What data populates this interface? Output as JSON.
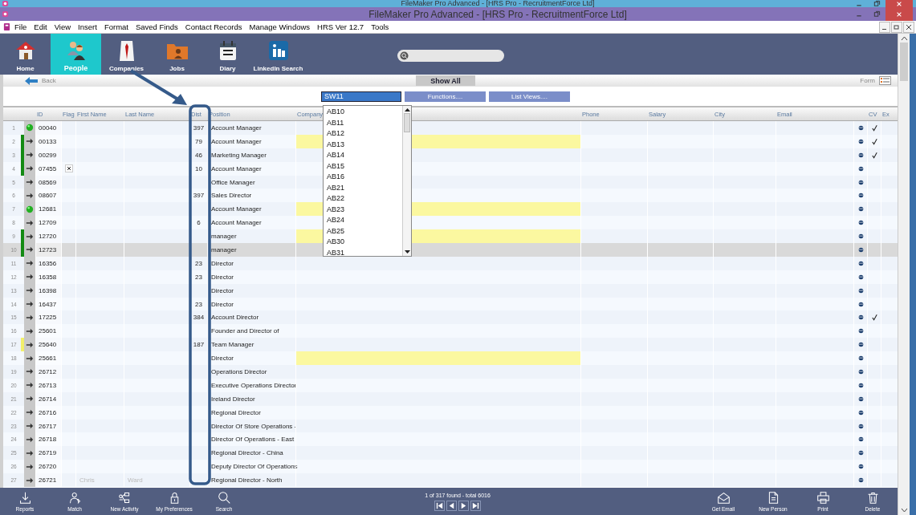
{
  "title_bars": [
    {
      "title": "FileMaker Pro Advanced - [HRS Pro - RecruitmentForce Ltd]",
      "active": false
    },
    {
      "title": "FileMaker Pro Advanced - [HRS Pro - RecruitmentForce Ltd]",
      "active": true
    }
  ],
  "menu": [
    "File",
    "Edit",
    "View",
    "Insert",
    "Format",
    "Saved Finds",
    "Contact Records",
    "Manage Windows",
    "HRS Ver 12.7",
    "Tools"
  ],
  "nav": [
    {
      "label": "Home",
      "kind": "home",
      "selected": false
    },
    {
      "label": "People",
      "kind": "people",
      "selected": true
    },
    {
      "label": "Companies",
      "kind": "shirt",
      "selected": false
    },
    {
      "label": "Jobs",
      "kind": "folder",
      "selected": false
    },
    {
      "label": "Diary",
      "kind": "calendar",
      "selected": false
    },
    {
      "label": "LinkedIn Search",
      "kind": "linkedin",
      "selected": false
    }
  ],
  "subbar": {
    "back": "Back",
    "show_all": "Show All",
    "view": "Form"
  },
  "filter": {
    "value": "SW11",
    "buttons": [
      "Functions....",
      "List Views...."
    ]
  },
  "dropdown": [
    "AB10",
    "AB11",
    "AB12",
    "AB13",
    "AB14",
    "AB15",
    "AB16",
    "AB21",
    "AB22",
    "AB23",
    "AB24",
    "AB25",
    "AB30",
    "AB31"
  ],
  "columns": [
    "ID",
    "Flag",
    "First Name",
    "Last Name",
    "Dist",
    "Position",
    "Company",
    "Phone",
    "Salary",
    "City",
    "Email",
    "CV",
    "Ex"
  ],
  "rows": [
    {
      "n": "1",
      "kind": "dot",
      "id": "00040",
      "flagged": false,
      "dist": "397",
      "position": "Account Manager",
      "highlight": false,
      "cv": true,
      "selected": false
    },
    {
      "n": "2",
      "kind": "arrow",
      "color": "#138a13",
      "id": "00133",
      "flagged": false,
      "dist": "79",
      "position": "Account Manager",
      "highlight": true,
      "cv": true,
      "selected": false
    },
    {
      "n": "3",
      "kind": "arrow",
      "color": "#138a13",
      "id": "00299",
      "flagged": false,
      "dist": "46",
      "position": "Marketing Manager",
      "highlight": false,
      "cv": true,
      "selected": false
    },
    {
      "n": "4",
      "kind": "arrow",
      "color": "#138a13",
      "id": "07455",
      "flagged": true,
      "dist": "10",
      "position": "Account Manager",
      "highlight": false,
      "cv": false,
      "selected": false
    },
    {
      "n": "5",
      "kind": "arrow",
      "id": "08569",
      "flagged": false,
      "dist": "",
      "position": "Office Manager",
      "highlight": false,
      "cv": false,
      "selected": false
    },
    {
      "n": "6",
      "kind": "arrow",
      "id": "08607",
      "flagged": false,
      "dist": "397",
      "position": "Sales Director",
      "highlight": false,
      "cv": false,
      "selected": false
    },
    {
      "n": "7",
      "kind": "dot",
      "id": "12681",
      "flagged": false,
      "dist": "",
      "position": "Account Manager",
      "highlight": true,
      "cv": false,
      "selected": false
    },
    {
      "n": "8",
      "kind": "arrow",
      "id": "12709",
      "flagged": false,
      "dist": "6",
      "position": "Account Manager",
      "highlight": false,
      "cv": false,
      "selected": false
    },
    {
      "n": "9",
      "kind": "arrow",
      "color": "#138a13",
      "id": "12720",
      "flagged": false,
      "dist": "",
      "position": "manager",
      "highlight": true,
      "cv": false,
      "selected": false
    },
    {
      "n": "10",
      "kind": "arrow",
      "color": "#138a13",
      "id": "12723",
      "flagged": false,
      "dist": "",
      "position": "manager",
      "highlight": false,
      "cv": false,
      "selected": true
    },
    {
      "n": "11",
      "kind": "arrow",
      "id": "16356",
      "flagged": false,
      "dist": "23",
      "position": "Director",
      "highlight": false,
      "cv": false,
      "selected": false
    },
    {
      "n": "12",
      "kind": "arrow",
      "id": "16358",
      "flagged": false,
      "dist": "23",
      "position": "Director",
      "highlight": false,
      "cv": false,
      "selected": false
    },
    {
      "n": "13",
      "kind": "arrow",
      "id": "16398",
      "flagged": false,
      "dist": "",
      "position": "Director",
      "highlight": false,
      "cv": false,
      "selected": false
    },
    {
      "n": "14",
      "kind": "arrow",
      "id": "16437",
      "flagged": false,
      "dist": "23",
      "position": "Director",
      "highlight": false,
      "cv": false,
      "selected": false
    },
    {
      "n": "15",
      "kind": "arrow",
      "id": "17225",
      "flagged": false,
      "dist": "384",
      "position": "Account Director",
      "highlight": false,
      "cv": true,
      "selected": false
    },
    {
      "n": "16",
      "kind": "arrow",
      "id": "25601",
      "flagged": false,
      "dist": "",
      "position": "Founder and Director of",
      "highlight": false,
      "cv": false,
      "selected": false
    },
    {
      "n": "17",
      "kind": "arrow",
      "color": "#f2f06a",
      "id": "25640",
      "flagged": false,
      "dist": "187",
      "position": "Team Manager",
      "highlight": false,
      "cv": false,
      "selected": false
    },
    {
      "n": "18",
      "kind": "arrow",
      "id": "25661",
      "flagged": false,
      "dist": "",
      "position": "Director",
      "highlight": true,
      "cv": false,
      "selected": false
    },
    {
      "n": "19",
      "kind": "arrow",
      "id": "26712",
      "flagged": false,
      "dist": "",
      "position": "Operations Director",
      "highlight": false,
      "cv": false,
      "selected": false
    },
    {
      "n": "20",
      "kind": "arrow",
      "id": "26713",
      "flagged": false,
      "dist": "",
      "position": "Executive Operations Director",
      "highlight": false,
      "cv": false,
      "selected": false
    },
    {
      "n": "21",
      "kind": "arrow",
      "id": "26714",
      "flagged": false,
      "dist": "",
      "position": "Ireland Director",
      "highlight": false,
      "cv": false,
      "selected": false
    },
    {
      "n": "22",
      "kind": "arrow",
      "id": "26716",
      "flagged": false,
      "dist": "",
      "position": "Regional Director",
      "highlight": false,
      "cv": false,
      "selected": false
    },
    {
      "n": "23",
      "kind": "arrow",
      "id": "26717",
      "flagged": false,
      "dist": "",
      "position": "Director Of Store Operations -",
      "highlight": false,
      "cv": false,
      "selected": false
    },
    {
      "n": "24",
      "kind": "arrow",
      "id": "26718",
      "flagged": false,
      "dist": "",
      "position": "Director Of Operations - East",
      "highlight": false,
      "cv": false,
      "selected": false
    },
    {
      "n": "25",
      "kind": "arrow",
      "id": "26719",
      "flagged": false,
      "dist": "",
      "position": "Regional Director - China",
      "highlight": false,
      "cv": false,
      "selected": false
    },
    {
      "n": "26",
      "kind": "arrow",
      "id": "26720",
      "flagged": false,
      "dist": "",
      "position": "Deputy Director Of Operations",
      "highlight": false,
      "cv": false,
      "selected": false
    },
    {
      "n": "27",
      "kind": "arrow",
      "id": "26721",
      "first_name": "Chris",
      "last_name": "Ward",
      "flagged": false,
      "dist": "",
      "position": "Regional Director - North",
      "highlight": false,
      "cv": false,
      "selected": false
    }
  ],
  "status": "1 of 317 found - total 6016",
  "bottom_left": [
    {
      "label": "Reports",
      "kind": "download"
    },
    {
      "label": "Match",
      "kind": "person"
    },
    {
      "label": "New Activity",
      "kind": "network"
    },
    {
      "label": "My Preferences",
      "kind": "lock"
    },
    {
      "label": "Search",
      "kind": "search"
    }
  ],
  "bottom_right": [
    {
      "label": "Get Email",
      "kind": "mail"
    },
    {
      "label": "New Person",
      "kind": "document"
    },
    {
      "label": "Print",
      "kind": "printer"
    },
    {
      "label": "Delete",
      "kind": "trash"
    }
  ]
}
